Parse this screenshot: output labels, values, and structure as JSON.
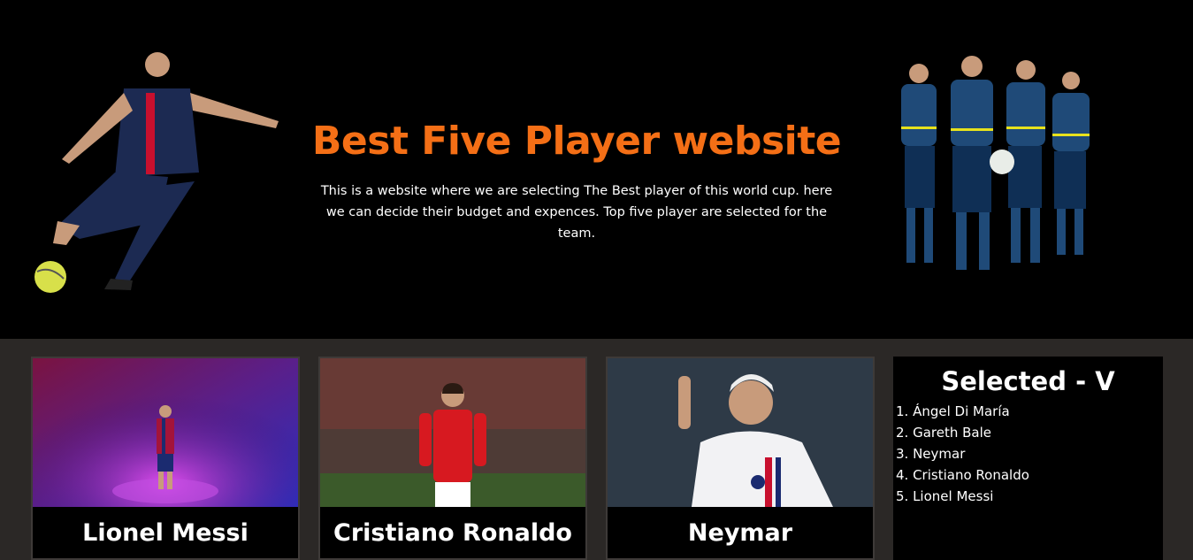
{
  "hero": {
    "title": "Best Five Player website",
    "description": "This is a website where we are selecting The Best player of this world cup. here we can decide their budget and expences. Top five player are selected for the team.",
    "left_image": "football-striker-kicking-photo",
    "right_image": "team-players-group-photo"
  },
  "colors": {
    "title_accent": "#f46f16",
    "hero_bg": "#000000",
    "page_bg": "#2b2826"
  },
  "players": [
    {
      "name": "Lionel Messi",
      "image": "messi-photo"
    },
    {
      "name": "Cristiano Ronaldo",
      "image": "ronaldo-photo"
    },
    {
      "name": "Neymar",
      "image": "neymar-photo"
    }
  ],
  "selected": {
    "title": "Selected - V",
    "items": [
      "1. Ángel Di María",
      "2. Gareth Bale",
      "3. Neymar",
      "4. Cristiano Ronaldo",
      "5. Lionel Messi"
    ]
  }
}
